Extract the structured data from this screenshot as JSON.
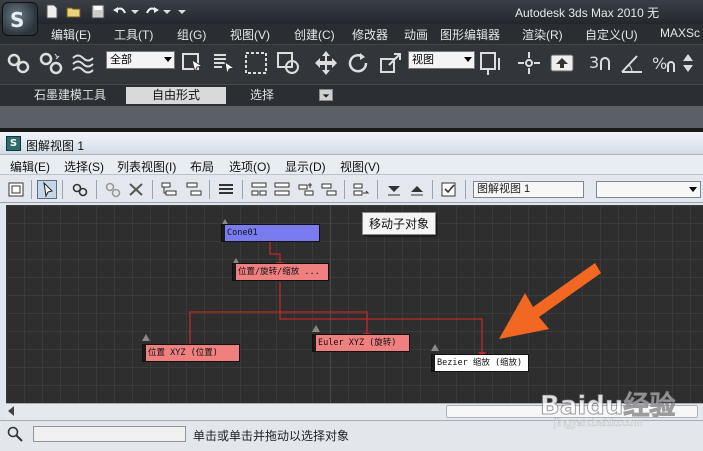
{
  "app": {
    "title": "Autodesk 3ds Max  2010     无"
  },
  "main_menu": {
    "items": [
      "编辑(E)",
      "工具(T)",
      "组(G)",
      "视图(V)",
      "创建(C)",
      "修改器",
      "动画",
      "图形编辑器",
      "渲染(R)",
      "自定义(U)",
      "MAXSc"
    ]
  },
  "main_toolbar": {
    "selection_filter": "全部",
    "coordinate_system": "视图",
    "snap_label": "3"
  },
  "ribbon": {
    "tabs": [
      "石墨建模工具",
      "自由形式",
      "选择"
    ],
    "active_tab": "自由形式"
  },
  "schematic": {
    "title": "图解视图 1",
    "menu": [
      "编辑(E)",
      "选择(S)",
      "列表视图(I)",
      "布局",
      "选项(O)",
      "显示(D)",
      "视图(V)"
    ],
    "name_field": "图解视图 1",
    "tooltip": "移动子对象",
    "nodes": {
      "root": "Cone01",
      "controller": "位置/旋转/缩放 ...",
      "position": "位置 XYZ (位置)",
      "rotation": "Euler XYZ (旋转)",
      "scale": "Bezier 缩放 (缩放)"
    },
    "status_text": "单击或单击并拖动以选择对象"
  },
  "colors": {
    "node_root": "#7b7bf0",
    "node_controller": "#f08080",
    "node_selected": "#ffffff",
    "link": "#b02020",
    "arrow": "#f26722"
  },
  "watermark": {
    "brand": "Baidu经验",
    "url": "jingyan.baidu.com"
  }
}
